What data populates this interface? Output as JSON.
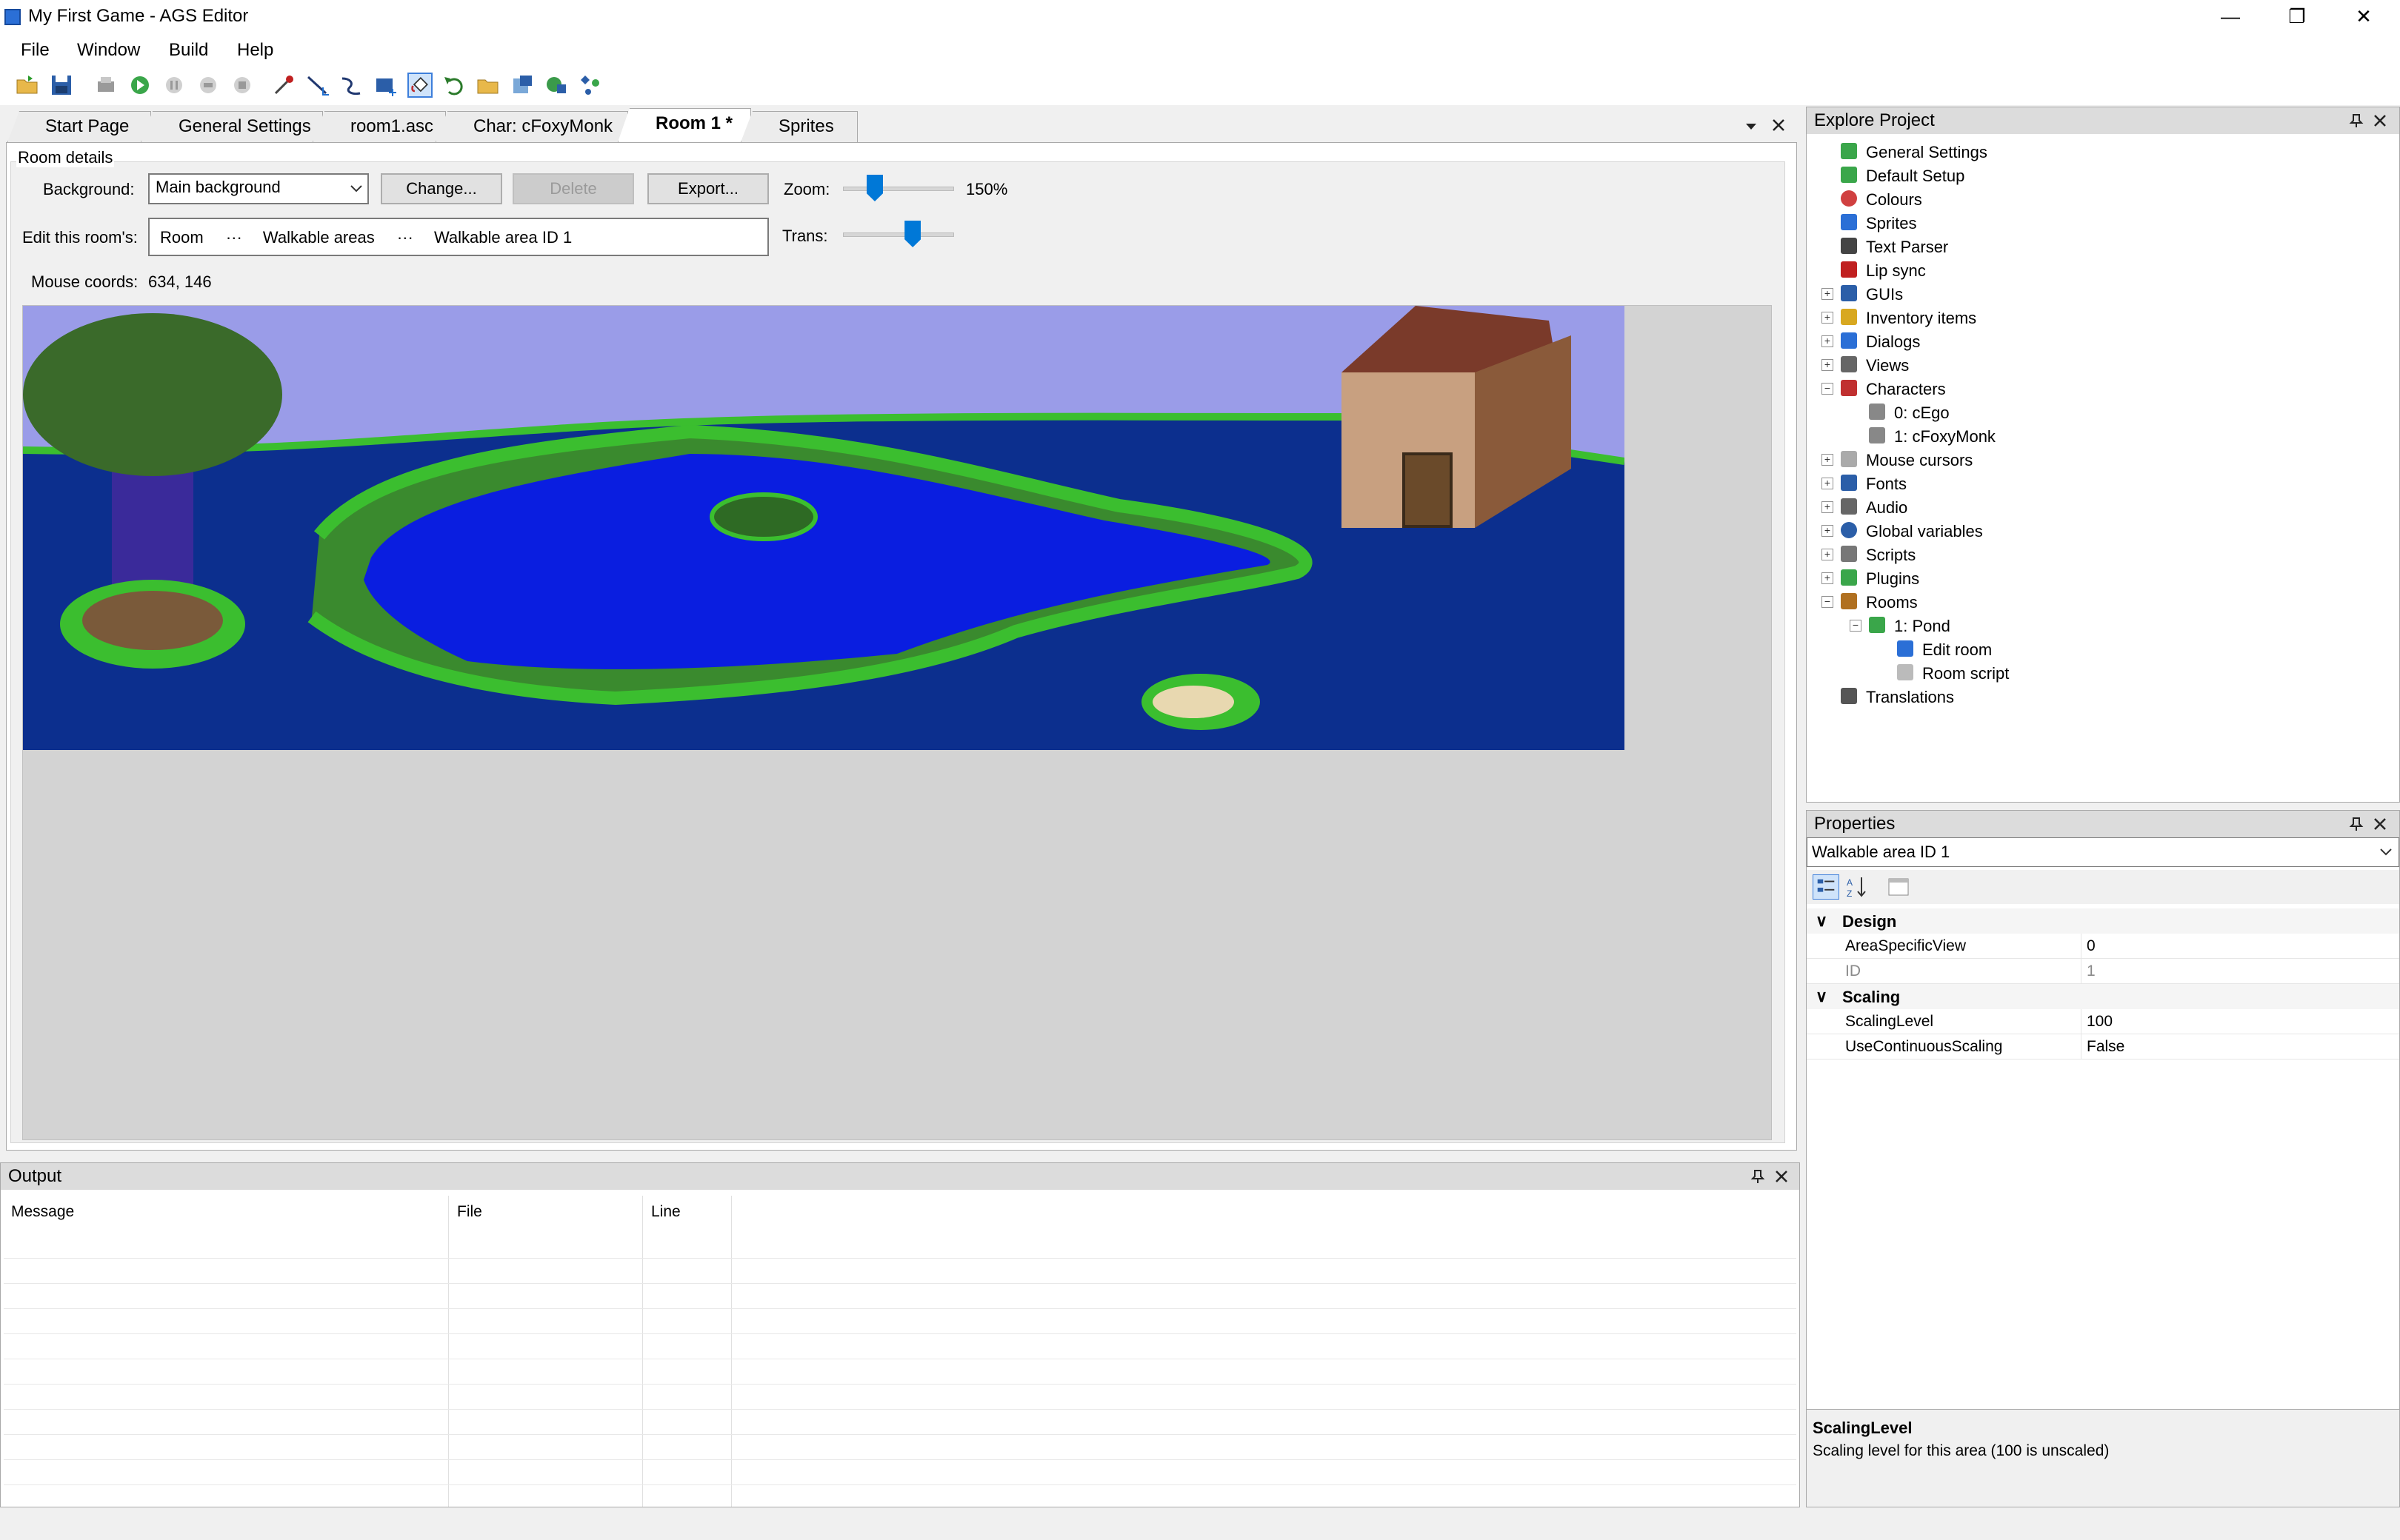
{
  "window": {
    "title": "My First Game - AGS Editor",
    "min": "—",
    "restore": "❐",
    "close": "✕"
  },
  "menu": [
    "File",
    "Window",
    "Build",
    "Help"
  ],
  "tabs": [
    "Start Page",
    "General Settings",
    "room1.asc",
    "Char: cFoxyMonk",
    "Room 1 *",
    "Sprites"
  ],
  "room": {
    "section_label": "Room details",
    "background_label": "Background:",
    "background_value": "Main background",
    "change_button": "Change...",
    "delete_button": "Delete",
    "export_button": "Export...",
    "zoom_label": "Zoom:",
    "zoom_value": "150%",
    "zoom_level": 0.25,
    "edit_label": "Edit this room's:",
    "breadcrumb": [
      "Room",
      "Walkable areas",
      "Walkable area ID 1"
    ],
    "breadcrumb_sep": "···",
    "trans_label": "Trans:",
    "trans_level": 0.65,
    "mouse_label": "Mouse coords:",
    "mouse_value": "634, 146"
  },
  "output": {
    "title": "Output",
    "columns": [
      "Message",
      "File",
      "Line"
    ]
  },
  "explore": {
    "title": "Explore Project",
    "items": [
      {
        "label": "General Settings",
        "icon": "check-icon"
      },
      {
        "label": "Default Setup",
        "icon": "check-icon"
      },
      {
        "label": "Colours",
        "icon": "palette-icon"
      },
      {
        "label": "Sprites",
        "icon": "sprite-icon"
      },
      {
        "label": "Text Parser",
        "icon": "text-parser-icon"
      },
      {
        "label": "Lip sync",
        "icon": "lips-icon"
      },
      {
        "label": "GUIs",
        "icon": "gui-icon"
      },
      {
        "label": "Inventory items",
        "icon": "key-icon"
      },
      {
        "label": "Dialogs",
        "icon": "dialog-icon"
      },
      {
        "label": "Views",
        "icon": "views-icon"
      },
      {
        "label": "Characters",
        "icon": "characters-icon"
      },
      {
        "label": "0: cEgo",
        "icon": "character-icon"
      },
      {
        "label": "1: cFoxyMonk",
        "icon": "character-icon"
      },
      {
        "label": "Mouse cursors",
        "icon": "cursor-icon"
      },
      {
        "label": "Fonts",
        "icon": "font-icon"
      },
      {
        "label": "Audio",
        "icon": "speaker-icon"
      },
      {
        "label": "Global variables",
        "icon": "globe-icon"
      },
      {
        "label": "Scripts",
        "icon": "script-icon"
      },
      {
        "label": "Plugins",
        "icon": "plugin-icon"
      },
      {
        "label": "Rooms",
        "icon": "rooms-icon"
      },
      {
        "label": "1: Pond",
        "icon": "room-icon"
      },
      {
        "label": "Edit room",
        "icon": "edit-room-icon"
      },
      {
        "label": "Room script",
        "icon": "script-page-icon"
      },
      {
        "label": "Translations",
        "icon": "translation-icon"
      }
    ]
  },
  "properties": {
    "title": "Properties",
    "selector": "Walkable area ID 1",
    "categories": [
      {
        "name": "Design",
        "rows": [
          {
            "name": "AreaSpecificView",
            "value": "0",
            "readonly": false
          },
          {
            "name": "ID",
            "value": "1",
            "readonly": true
          }
        ]
      },
      {
        "name": "Scaling",
        "rows": [
          {
            "name": "ScalingLevel",
            "value": "100",
            "readonly": false
          },
          {
            "name": "UseContinuousScaling",
            "value": "False",
            "readonly": false
          }
        ]
      }
    ],
    "help_title": "ScalingLevel",
    "help_text": "Scaling level for this area (100 is unscaled)"
  }
}
